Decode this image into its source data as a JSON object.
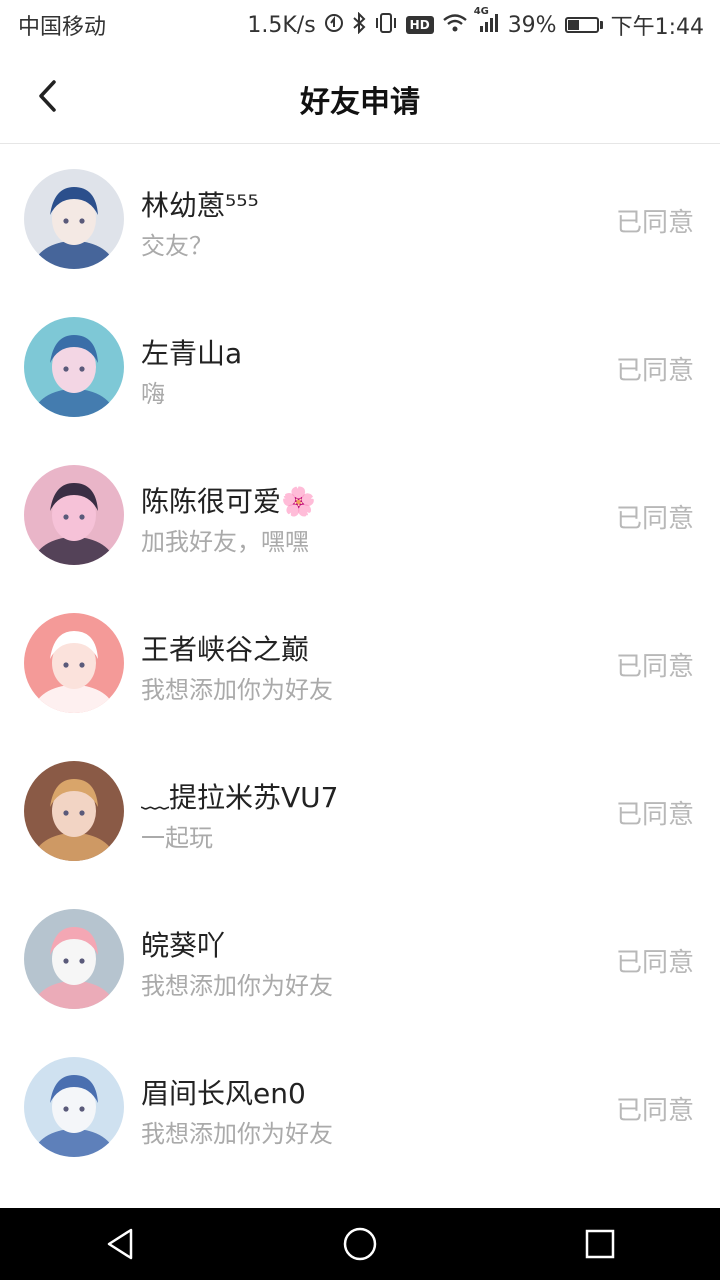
{
  "status_bar": {
    "carrier": "中国移动",
    "speed": "1.5K/s",
    "hd": "HD",
    "network": "4G",
    "battery": "39%",
    "battery_level": 0.39,
    "time": "下午1:44"
  },
  "header": {
    "title": "好友申请",
    "back_icon": "chevron-left-icon"
  },
  "requests": [
    {
      "name": "林幼蒽⁵⁵⁵",
      "message": "交友？",
      "status": "已同意",
      "avatar_colors": [
        "#dfe3ea",
        "#2b4f8c",
        "#f4e9e4"
      ]
    },
    {
      "name": "左青山a",
      "message": "嗨",
      "status": "已同意",
      "avatar_colors": [
        "#7ec8d6",
        "#3a6ea8",
        "#f3d6e4"
      ]
    },
    {
      "name": "陈陈很可爱🌸",
      "message": "加我好友，嘿嘿",
      "status": "已同意",
      "avatar_colors": [
        "#e9b5c8",
        "#3a2e44",
        "#f6c2d8"
      ]
    },
    {
      "name": "王者峡谷之巅",
      "message": "我想添加你为好友",
      "status": "已同意",
      "avatar_colors": [
        "#f49a98",
        "#ffffff",
        "#fbe2dc"
      ]
    },
    {
      "name": "﹏提拉米苏VU7",
      "message": "一起玩",
      "status": "已同意",
      "avatar_colors": [
        "#8a5a46",
        "#d9a56a",
        "#f2d4c4"
      ]
    },
    {
      "name": "皖葵吖",
      "message": "我想添加你为好友",
      "status": "已同意",
      "avatar_colors": [
        "#b6c4cf",
        "#f4a7b4",
        "#f6f6f6"
      ]
    },
    {
      "name": "眉间长风en0",
      "message": "我想添加你为好友",
      "status": "已同意",
      "avatar_colors": [
        "#cfe1f0",
        "#4a6fb0",
        "#f4f6f9"
      ]
    }
  ],
  "nav": {
    "back_icon": "triangle-back-icon",
    "home_icon": "circle-home-icon",
    "recents_icon": "square-recents-icon"
  }
}
